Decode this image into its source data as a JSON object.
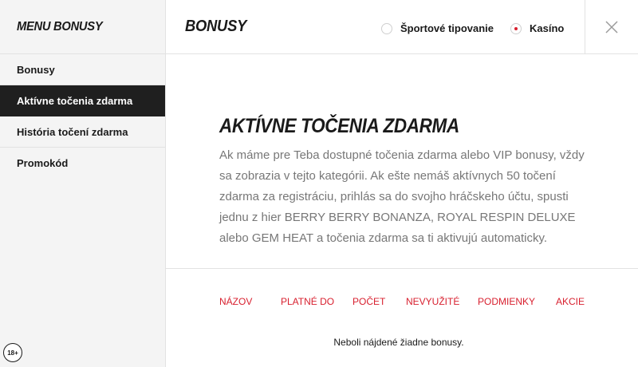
{
  "sidebar": {
    "title": "MENU BONUSY",
    "items": [
      {
        "label": "Bonusy",
        "active": false
      },
      {
        "label": "Aktívne točenia zdarma",
        "active": true
      },
      {
        "label": "História točení zdarma",
        "active": false
      },
      {
        "label": "Promokód",
        "active": false
      }
    ],
    "age_badge": "18+"
  },
  "header": {
    "title": "BONUSY",
    "radios": [
      {
        "label": "Športové tipovanie",
        "selected": false
      },
      {
        "label": "Kasíno",
        "selected": true
      }
    ],
    "close_icon": "close-icon"
  },
  "content": {
    "title": "AKTÍVNE TOČENIA ZDARMA",
    "description": "Ak máme pre Teba dostupné točenia zdarma alebo VIP bonusy, vždy sa zobrazia v tejto kategórii. Ak ešte nemáš aktívnych 50 točení zdarma za registráciu, prihlás sa do svojho hráčskeho účtu, spusti jednu z hier BERRY BERRY BONANZA, ROYAL RESPIN DELUXE alebo GEM HEAT a točenia zdarma sa ti aktivujú automaticky.",
    "table": {
      "columns": [
        "NÁZOV",
        "PLATNÉ DO",
        "POČET",
        "NEVYUŽITÉ",
        "PODMIENKY",
        "AKCIE"
      ],
      "empty_message": "Neboli nájdené žiadne bonusy."
    }
  },
  "colors": {
    "accent": "#d8202f",
    "active_bg": "#1f1f1f",
    "sidebar_bg": "#f4f4f4",
    "body_text": "#777777"
  }
}
